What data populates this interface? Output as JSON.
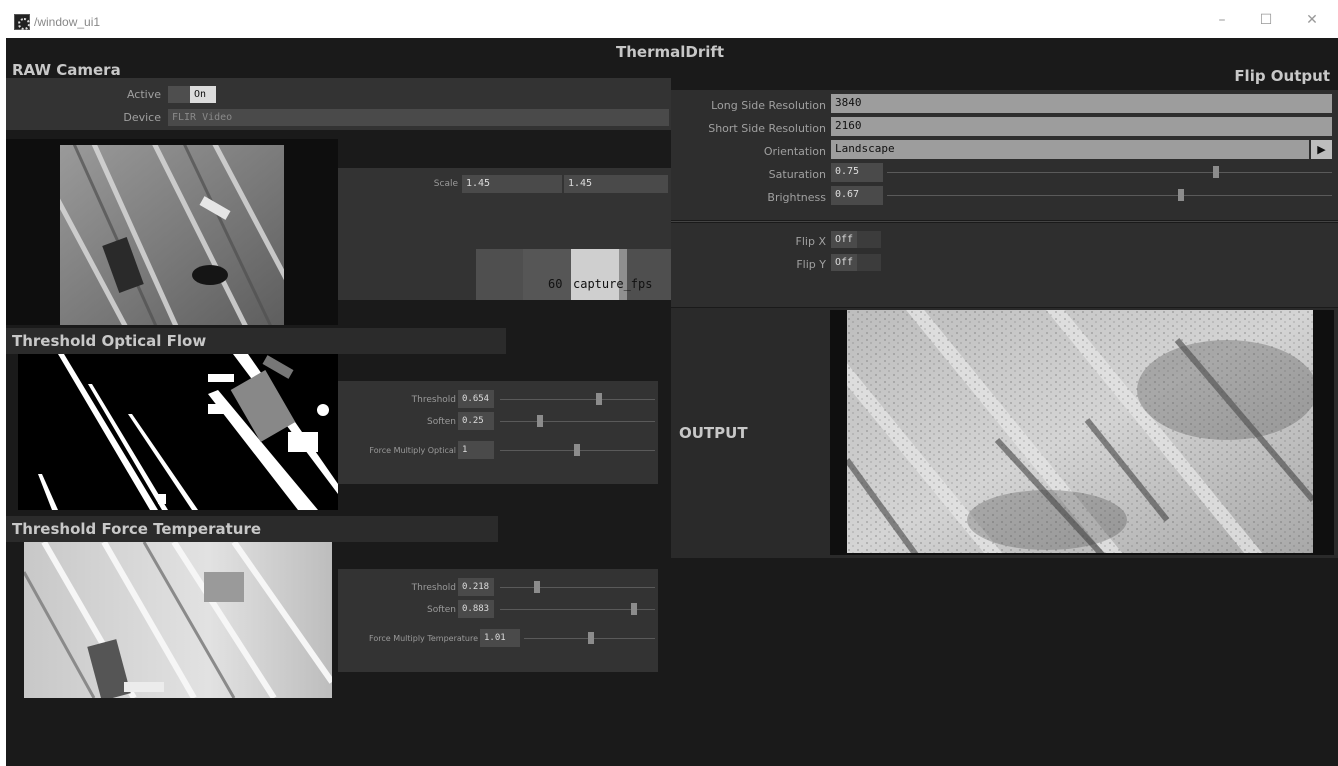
{
  "window": {
    "title": "/window_ui1",
    "minimize": "–",
    "maximize": "☐",
    "close": "✕"
  },
  "app": {
    "title": "ThermalDrift"
  },
  "raw_camera": {
    "heading": "RAW Camera",
    "active_label": "Active",
    "active_value": "On",
    "device_label": "Device",
    "device_value": "FLIR Video",
    "scale_label": "Scale",
    "scale_x": "1.45",
    "scale_y": "1.45",
    "fps_value": "60",
    "fps_label": "capture_fps"
  },
  "threshold_optical": {
    "heading": "Threshold Optical Flow",
    "threshold_label": "Threshold",
    "threshold_value": "0.654",
    "threshold_level": 0.654,
    "soften_label": "Soften",
    "soften_value": "0.25",
    "soften_level": 0.25,
    "force_label": "Force Multiply Optical",
    "force_value": "1",
    "force_level": 0.5
  },
  "threshold_temperature": {
    "heading": "Threshold Force Temperature",
    "threshold_label": "Threshold",
    "threshold_value": "0.218",
    "threshold_level": 0.218,
    "soften_label": "Soften",
    "soften_value": "0.883",
    "soften_level": 0.883,
    "force_label": "Force Multiply Temperature",
    "force_value": "1.01",
    "force_level": 0.505
  },
  "flip_output": {
    "heading": "Flip Output",
    "long_side_label": "Long Side Resolution",
    "long_side_value": "3840",
    "short_side_label": "Short Side Resolution",
    "short_side_value": "2160",
    "orientation_label": "Orientation",
    "orientation_value": "Landscape",
    "saturation_label": "Saturation",
    "saturation_value": "0.75",
    "saturation_level": 0.75,
    "brightness_label": "Brightness",
    "brightness_value": "0.67",
    "brightness_level": 0.67,
    "flip_x_label": "Flip X",
    "flip_x_value": "Off",
    "flip_y_label": "Flip Y",
    "flip_y_value": "Off"
  },
  "output": {
    "label": "OUTPUT"
  }
}
